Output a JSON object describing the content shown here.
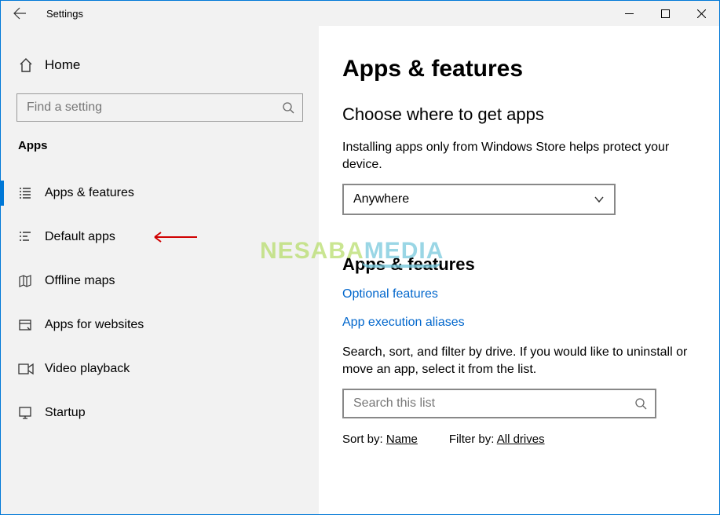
{
  "window": {
    "title": "Settings"
  },
  "sidebar": {
    "home": "Home",
    "search_placeholder": "Find a setting",
    "category": "Apps",
    "items": [
      {
        "label": "Apps & features",
        "icon": "list-icon",
        "active": true
      },
      {
        "label": "Default apps",
        "icon": "defaults-icon",
        "annotated": true
      },
      {
        "label": "Offline maps",
        "icon": "map-icon"
      },
      {
        "label": "Apps for websites",
        "icon": "app-website-icon"
      },
      {
        "label": "Video playback",
        "icon": "video-icon"
      },
      {
        "label": "Startup",
        "icon": "startup-icon"
      }
    ]
  },
  "main": {
    "heading": "Apps & features",
    "section_get_apps": {
      "title": "Choose where to get apps",
      "desc": "Installing apps only from Windows Store helps protect your device.",
      "dropdown_value": "Anywhere"
    },
    "section_apps_features": {
      "title": "Apps & features",
      "link_optional": "Optional features",
      "link_aliases": "App execution aliases",
      "desc": "Search, sort, and filter by drive. If you would like to uninstall or move an app, select it from the list.",
      "search_placeholder": "Search this list",
      "sort_label": "Sort by:",
      "sort_value": "Name",
      "filter_label": "Filter by:",
      "filter_value": "All drives"
    }
  },
  "watermark": {
    "part1": "NESABA",
    "part2": "MEDIA"
  }
}
